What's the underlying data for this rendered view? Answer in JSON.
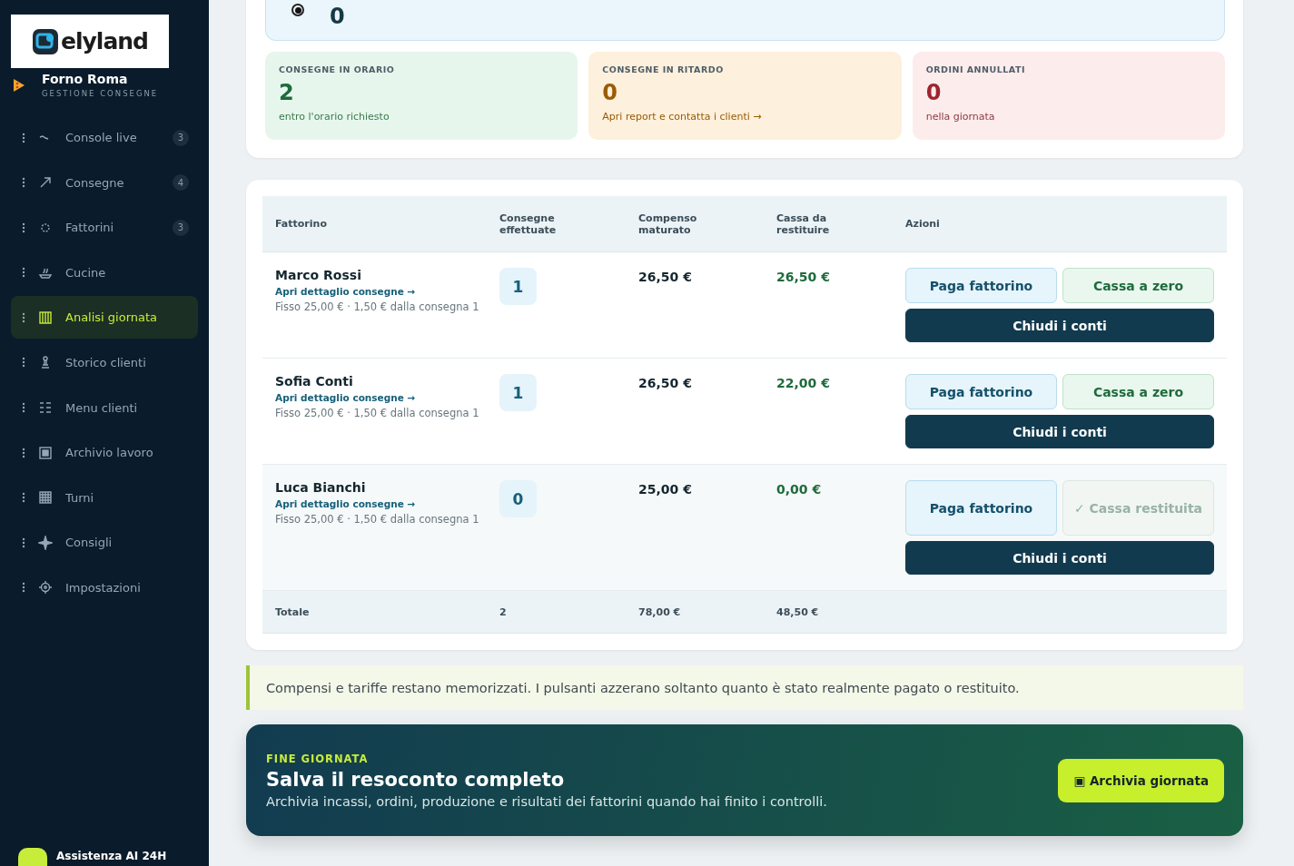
{
  "brand": {
    "logo": "elyland",
    "store": "Forno Roma",
    "subtitle": "GESTIONE CONSEGNE"
  },
  "sidebar": {
    "items": [
      {
        "label": "Console live",
        "count": "3",
        "selected": false
      },
      {
        "label": "Consegne",
        "count": "4",
        "selected": false
      },
      {
        "label": "Fattorini",
        "count": "3",
        "selected": false
      },
      {
        "label": "Cucine",
        "selected": false
      },
      {
        "label": "Analisi giornata",
        "selected": true
      },
      {
        "label": "Storico clienti",
        "selected": false
      },
      {
        "label": "Menu clienti",
        "selected": false
      },
      {
        "label": "Archivio lavoro",
        "selected": false
      },
      {
        "label": "Turni",
        "selected": false
      },
      {
        "label": "Consigli",
        "selected": false
      },
      {
        "label": "Impostazioni",
        "selected": false
      }
    ],
    "assistant": "Assistenza AI 24H"
  },
  "top_option": {
    "value": "0",
    "selected": true
  },
  "stats": [
    {
      "kind": "good",
      "label": "CONSEGNE IN ORARIO",
      "value": "2",
      "note": "entro l'orario richiesto"
    },
    {
      "kind": "warn",
      "label": "CONSEGNE IN RITARDO",
      "value": "0",
      "note": "Apri report e contatta i clienti →"
    },
    {
      "kind": "bad",
      "label": "ORDINI ANNULLATI",
      "value": "0",
      "note": "nella giornata"
    }
  ],
  "table": {
    "columns": [
      "Fattorino",
      "Consegne effettuate",
      "Compenso maturato",
      "Cassa da restituire",
      "Azioni"
    ],
    "rows": [
      {
        "name": "Marco Rossi",
        "link": "Apri dettaglio consegne →",
        "tariff": "Fisso 25,00 € · 1,50 € dalla consegna 1",
        "deliveries": "1",
        "earned": "26,50 €",
        "cash": "26,50 €",
        "pay": "Paga fattorino",
        "cash_button": "Cassa a zero",
        "cash_returned": false,
        "close": "Chiudi i conti"
      },
      {
        "name": "Sofia Conti",
        "link": "Apri dettaglio consegne →",
        "tariff": "Fisso 25,00 € · 1,50 € dalla consegna 1",
        "deliveries": "1",
        "earned": "26,50 €",
        "cash": "22,00 €",
        "pay": "Paga fattorino",
        "cash_button": "Cassa a zero",
        "cash_returned": false,
        "close": "Chiudi i conti"
      },
      {
        "name": "Luca Bianchi",
        "link": "Apri dettaglio consegne →",
        "tariff": "Fisso 25,00 € · 1,50 € dalla consegna 1",
        "deliveries": "0",
        "earned": "25,00 €",
        "cash": "0,00 €",
        "pay": "Paga fattorino",
        "cash_button": "✓ Cassa restituita",
        "cash_returned": true,
        "close": "Chiudi i conti"
      }
    ],
    "total": {
      "label": "Totale",
      "deliveries": "2",
      "earned": "78,00 €",
      "cash": "48,50 €"
    }
  },
  "note": "Compensi e tariffe restano memorizzati. I pulsanti azzerano soltanto quanto è stato realmente pagato o restituito.",
  "banner": {
    "eyebrow": "FINE GIORNATA",
    "title": "Salva il resoconto completo",
    "text": "Archivia incassi, ordini, produzione e risultati dei fattorini quando hai finito i controlli.",
    "icon": "▣",
    "button": "Archivia giornata"
  }
}
